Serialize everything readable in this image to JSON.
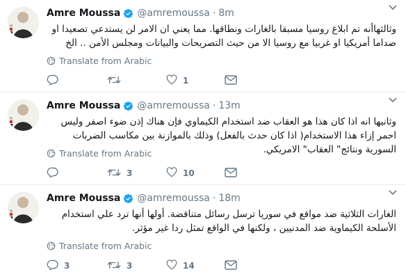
{
  "tweets": [
    {
      "name": "Amre Moussa",
      "handle": "@amremoussa",
      "separator": "·",
      "time": "8m",
      "text": "وثالثهاأنه تم ابلاغ روسيا مسبقا بالغارات ونطاقها. مما يعني ان الامر لن يستدعي تصعيدا او صداما أمريكيا او غربيا مع روسيا الا من حيث التصريحات والبيانات ومجلس الأمن .. الخ",
      "translate_label": "Translate from Arabic",
      "reply_count": "",
      "retweet_count": "",
      "like_count": "1"
    },
    {
      "name": "Amre Moussa",
      "handle": "@amremoussa",
      "separator": "·",
      "time": "13m",
      "text": "وثانيها انه اذا كان هذا هو العقاب ضد استخدام الكيماوي فإن هناك إذن ضوء اصفر وليس احمر إزاء هذا الاستخدام( اذا كان حدث بالفعل) وذلك بالموازنة بين مكاسب الضربات السورية ونتائج\" العقاب\" الامريكي.",
      "translate_label": "Translate from Arabic",
      "reply_count": "",
      "retweet_count": "3",
      "like_count": "10"
    },
    {
      "name": "Amre Moussa",
      "handle": "@amremoussa",
      "separator": "·",
      "time": "18m",
      "text": "الغارات الثلاثية ضد مواقع في سوريا ترسل رسائل متناقضة. أولها أنها ترد علي استخدام الأسلحة الكيماوية ضد المدنيين ، ولكنها في الواقع تمثل ردا غير مؤثر.",
      "translate_label": "Translate from Arabic",
      "reply_count": "3",
      "retweet_count": "3",
      "like_count": "14"
    }
  ],
  "colors": {
    "verified": "#1da1f2",
    "muted": "#657786",
    "text": "#14171a",
    "divider": "#e6ecf0"
  }
}
